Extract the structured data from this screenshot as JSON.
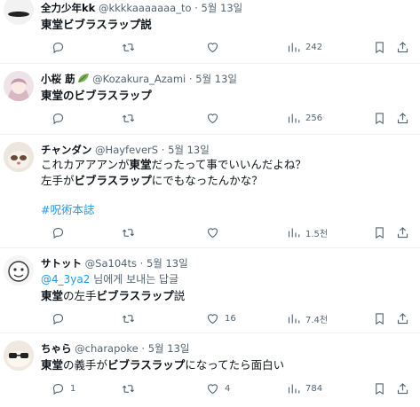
{
  "tweets": [
    {
      "name": "全力少年kk",
      "handle": "@kkkkaaaaaaa_to",
      "dot": "·",
      "date": "5월 13일",
      "text": "東堂ビブラスラップ説",
      "replies": "",
      "retweets": "",
      "likes": "",
      "views": "242"
    },
    {
      "name": "小桜 莇",
      "handle": "@Kozakura_Azami",
      "dot": "·",
      "date": "5월 13일",
      "text": "東堂のビブラスラップ",
      "replies": "",
      "retweets": "",
      "likes": "",
      "views": "256"
    },
    {
      "name": "チャンダン",
      "handle": "@HayfeverS",
      "dot": "·",
      "date": "5월 13일",
      "line1_a": "これカアアアンが",
      "line1_b": "東堂",
      "line1_c": "だったって事でいいんだよね？",
      "line2_a": "左手が",
      "line2_b": "ビブラスラップ",
      "line2_c": "にでもなったんかな？",
      "hashtag": "#呪術本誌",
      "replies": "",
      "retweets": "",
      "likes": "",
      "views": "1.5천"
    },
    {
      "name": "サトット",
      "handle": "@Sa104ts",
      "dot": "·",
      "date": "5월 13일",
      "reply_to_handle": "@4_3ya2",
      "reply_to_suffix": " 님에게 보내는 답글",
      "text_a": "東堂",
      "text_b": "の左手",
      "text_c": "ビブラスラップ",
      "text_d": "説",
      "replies": "",
      "retweets": "",
      "likes": "16",
      "views": "7.4천"
    },
    {
      "name": "ちゃら",
      "handle": "@charapoke",
      "dot": "·",
      "date": "5월 13일",
      "text_a": "東堂",
      "text_b": "の義手が",
      "text_c": "ビブラスラップ",
      "text_d": "になってたら面白い",
      "replies": "1",
      "retweets": "",
      "likes": "4",
      "views": "784"
    }
  ],
  "icons": {
    "reply": "reply-icon",
    "retweet": "retweet-icon",
    "like": "heart-icon",
    "views": "views-icon",
    "bookmark": "bookmark-icon",
    "share": "share-icon"
  },
  "colors": {
    "text": "#0f1419",
    "muted": "#536471",
    "link": "#1d9bf0",
    "divider": "#eff3f4"
  }
}
